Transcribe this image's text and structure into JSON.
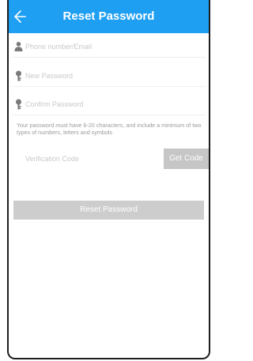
{
  "header": {
    "title": "Reset Password",
    "back_icon": "arrow-left-icon",
    "background_color": "#1e9ff2"
  },
  "form": {
    "account": {
      "placeholder": "Phone number/Email",
      "value": "",
      "icon": "person-icon"
    },
    "new_password": {
      "placeholder": "New Password",
      "value": "",
      "icon": "key-icon"
    },
    "confirm_password": {
      "placeholder": "Confirm Password",
      "value": "",
      "icon": "key-icon"
    },
    "hint": "Your password must have 6-20 characters, and include a minimum of two types of numbers, letters and symbols",
    "verification": {
      "placeholder": "Verification Code",
      "value": ""
    },
    "get_code_label": "Get Code",
    "submit_label": "Reset Password",
    "disabled_button_color": "#c9c9c9"
  }
}
